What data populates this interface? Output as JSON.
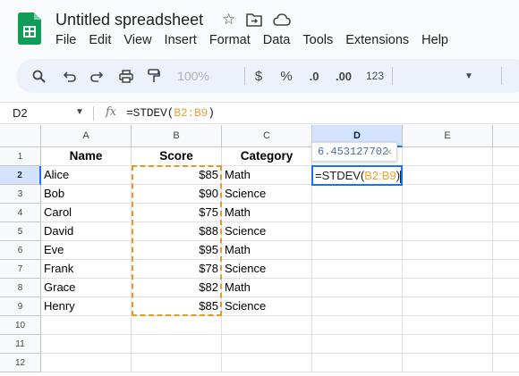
{
  "app": {
    "title": "Untitled spreadsheet",
    "menu": [
      "File",
      "Edit",
      "View",
      "Insert",
      "Format",
      "Data",
      "Tools",
      "Extensions",
      "Help"
    ]
  },
  "toolbar": {
    "zoom": "100%",
    "currency": "$",
    "percent": "%",
    "dec_decrease": ".0",
    "dec_increase": ".00",
    "number_format": "123"
  },
  "formula_bar": {
    "cell_ref": "D2",
    "fx": "fx",
    "formula_prefix": "=STDEV(",
    "formula_range": "B2:B9",
    "formula_suffix": ")"
  },
  "grid": {
    "columns": [
      "A",
      "B",
      "C",
      "D",
      "E"
    ],
    "rows": [
      "1",
      "2",
      "3",
      "4",
      "5",
      "6",
      "7",
      "8",
      "9",
      "10",
      "11",
      "12"
    ],
    "headers": [
      "Name",
      "Score",
      "Category"
    ],
    "data": [
      [
        "Alice",
        "$85",
        "Math"
      ],
      [
        "Bob",
        "$90",
        "Science"
      ],
      [
        "Carol",
        "$75",
        "Math"
      ],
      [
        "David",
        "$88",
        "Science"
      ],
      [
        "Eve",
        "$95",
        "Math"
      ],
      [
        "Frank",
        "$78",
        "Science"
      ],
      [
        "Grace",
        "$82",
        "Math"
      ],
      [
        "Henry",
        "$85",
        "Science"
      ]
    ],
    "active_cell": {
      "formula_prefix": "=STDEV(",
      "formula_range": "B2:B9",
      "formula_suffix": ")"
    },
    "preview": "6.453127702",
    "preview_close": "×"
  },
  "colors": {
    "accent": "#1a73e8",
    "range_highlight": "#e49b24",
    "selected_header": "#d3e3fd"
  }
}
